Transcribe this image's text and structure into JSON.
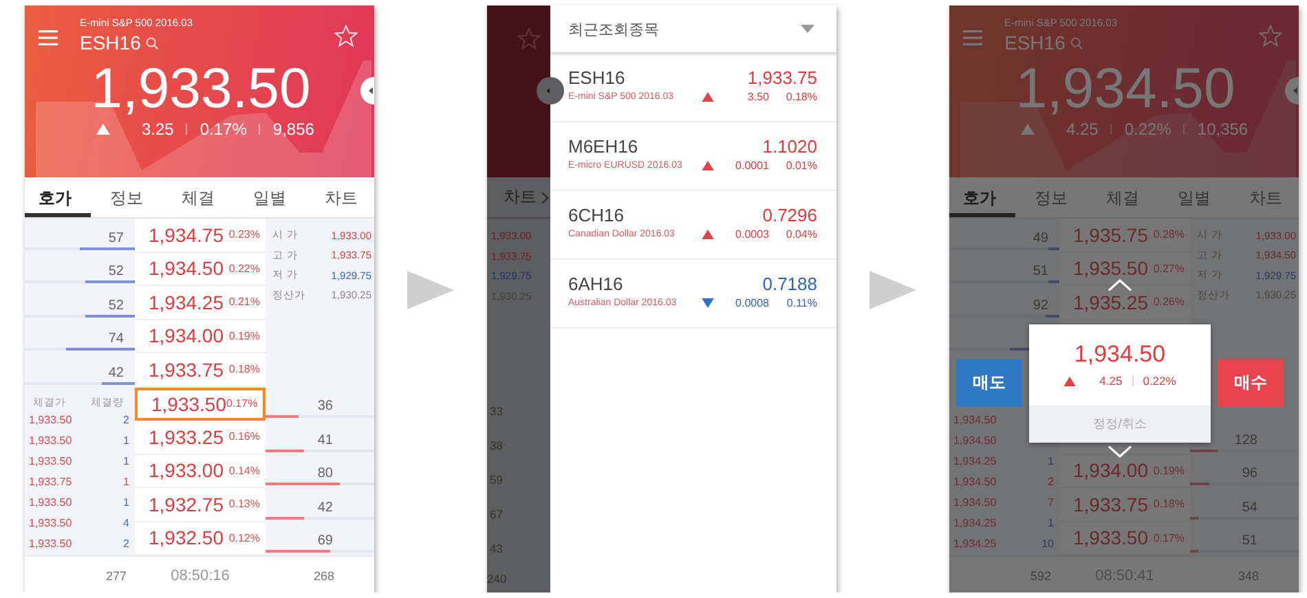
{
  "screens": [
    {
      "kind": "order_book",
      "dimmed": false,
      "header": {
        "subtitle": "E-mini S&P 500 2016.03",
        "symbol": "ESH16",
        "price": "1,933.50",
        "rising": true,
        "change": "3.25",
        "change_pct": "0.17%",
        "volume": "9,856"
      },
      "tabs": [
        {
          "label": "호가",
          "selected": true
        },
        {
          "label": "정보",
          "selected": false
        },
        {
          "label": "체결",
          "selected": false
        },
        {
          "label": "일별",
          "selected": false
        },
        {
          "label": "차트",
          "selected": false
        }
      ],
      "rows": [
        {
          "ask": {
            "qty": "57",
            "level": 0.5
          },
          "price": "1,934.75",
          "pct": "0.23%",
          "selected": false
        },
        {
          "ask": {
            "qty": "52",
            "level": 0.45
          },
          "price": "1,934.50",
          "pct": "0.22%",
          "selected": false
        },
        {
          "ask": {
            "qty": "52",
            "level": 0.45
          },
          "price": "1,934.25",
          "pct": "0.21%",
          "selected": false
        },
        {
          "ask": {
            "qty": "74",
            "level": 0.62
          },
          "price": "1,934.00",
          "pct": "0.19%",
          "selected": false
        },
        {
          "ask": {
            "qty": "42",
            "level": 0.3
          },
          "price": "1,933.75",
          "pct": "0.18%",
          "selected": false
        },
        {
          "bid": {
            "qty": "36",
            "level": 0.3
          },
          "price": "1,933.50",
          "pct": "0.17%",
          "selected": true
        },
        {
          "bid": {
            "qty": "41",
            "level": 0.35
          },
          "price": "1,933.25",
          "pct": "0.16%",
          "selected": false
        },
        {
          "bid": {
            "qty": "80",
            "level": 0.68
          },
          "price": "1,933.00",
          "pct": "0.14%",
          "selected": false
        },
        {
          "bid": {
            "qty": "42",
            "level": 0.35
          },
          "price": "1,932.75",
          "pct": "0.13%",
          "selected": false
        },
        {
          "bid": {
            "qty": "69",
            "level": 0.6
          },
          "price": "1,932.50",
          "pct": "0.12%",
          "selected": false
        }
      ],
      "summary": [
        {
          "label": "시 가",
          "value": "1,933.00",
          "color": "#e23a3e"
        },
        {
          "label": "고 가",
          "value": "1,933.75",
          "color": "#e23a3e"
        },
        {
          "label": "저 가",
          "value": "1,929.75",
          "color": "#3461c0"
        },
        {
          "label": "정산가",
          "value": "1,930.25",
          "color": "#888888"
        }
      ],
      "trades_header": [
        "체결가",
        "체결량"
      ],
      "trades": [
        {
          "price": "1,933.50",
          "qty": "2",
          "color": "#3f6cc4"
        },
        {
          "price": "1,933.50",
          "qty": "1",
          "color": "#3f6cc4"
        },
        {
          "price": "1,933.50",
          "qty": "1",
          "color": "#3f6cc4"
        },
        {
          "price": "1,933.75",
          "qty": "1",
          "color": "#e0484e"
        },
        {
          "price": "1,933.50",
          "qty": "1",
          "color": "#3f6cc4"
        },
        {
          "price": "1,933.50",
          "qty": "4",
          "color": "#3f6cc4"
        },
        {
          "price": "1,933.50",
          "qty": "2",
          "color": "#3f6cc4"
        }
      ],
      "footer": {
        "ask_total": "277",
        "time": "08:50:16",
        "bid_total": "268"
      }
    },
    {
      "kind": "recent_list",
      "background": {
        "tab": "차트",
        "summary": [
          {
            "value": "1,933.00",
            "color": "#6a2024"
          },
          {
            "value": "1,933.75",
            "color": "#6a2024"
          },
          {
            "value": "1,929.75",
            "color": "#22346a"
          },
          {
            "value": "1,930.25",
            "color": "#404042"
          }
        ],
        "quantities": [
          "33",
          "38",
          "59",
          "67",
          "43"
        ],
        "footer_value": "240"
      },
      "drawer": {
        "title": "최근조회종목",
        "items": [
          {
            "symbol": "ESH16",
            "name": "E-mini S&P 500 2016.03",
            "price": "1,933.75",
            "rising": true,
            "change": "3.50",
            "change_pct": "0.18%"
          },
          {
            "symbol": "M6EH16",
            "name": "E-micro EURUSD 2016.03",
            "price": "1.1020",
            "rising": true,
            "change": "0.0001",
            "change_pct": "0.01%"
          },
          {
            "symbol": "6CH16",
            "name": "Canadian Dollar 2016.03",
            "price": "0.7296",
            "rising": true,
            "change": "0.0003",
            "change_pct": "0.04%"
          },
          {
            "symbol": "6AH16",
            "name": "Australian Dollar 2016.03",
            "price": "0.7188",
            "rising": false,
            "change": "0.0008",
            "change_pct": "0.11%"
          }
        ]
      }
    },
    {
      "kind": "order_book",
      "dimmed": true,
      "header": {
        "subtitle": "E-mini S&P 500 2016.03",
        "symbol": "ESH16",
        "price": "1,934.50",
        "rising": true,
        "change": "4.25",
        "change_pct": "0.22%",
        "volume": "10,356"
      },
      "tabs": [
        {
          "label": "호가",
          "selected": true
        },
        {
          "label": "정보",
          "selected": false
        },
        {
          "label": "체결",
          "selected": false
        },
        {
          "label": "일별",
          "selected": false
        },
        {
          "label": "차트",
          "selected": false
        }
      ],
      "rows": [
        {
          "ask": {
            "qty": "49",
            "level": 0.1
          },
          "price": "1,935.75",
          "pct": "0.28%",
          "selected": false
        },
        {
          "ask": {
            "qty": "51",
            "level": 0.1
          },
          "price": "1,935.50",
          "pct": "0.27%",
          "selected": false
        },
        {
          "ask": {
            "qty": "92",
            "level": 0.12
          },
          "price": "1,935.25",
          "pct": "0.26%",
          "selected": false
        },
        {
          "ask": {
            "level": 0.45
          }
        },
        {},
        {},
        {
          "bid": {
            "qty": "128",
            "level": 0.25
          },
          "selected": false
        },
        {
          "bid": {
            "qty": "96",
            "level": 0.18
          },
          "price": "1,934.00",
          "pct": "0.19%",
          "selected": false
        },
        {
          "bid": {
            "qty": "54",
            "level": 0.08
          },
          "price": "1,933.75",
          "pct": "0.18%",
          "selected": false
        },
        {
          "bid": {
            "qty": "51",
            "level": 0.08
          },
          "price": "1,933.50",
          "pct": "0.17%",
          "selected": false
        }
      ],
      "summary": [
        {
          "label": "시 가",
          "value": "1,933.00",
          "color": "#6b282a"
        },
        {
          "label": "고 가",
          "value": "1,934.50",
          "color": "#6b282a"
        },
        {
          "label": "저 가",
          "value": "1,929.75",
          "color": "#26385e"
        },
        {
          "label": "정산가",
          "value": "1,930.25",
          "color": "#474747"
        }
      ],
      "trades": [
        {
          "price": "1,934.50"
        },
        {
          "price": "1,934.50"
        },
        {
          "price": "1,934.25",
          "qty": "1",
          "color": "#2a3c5f"
        },
        {
          "price": "1,934.50",
          "qty": "2",
          "color": "#6b2e30"
        },
        {
          "price": "1,934.50",
          "qty": "7",
          "color": "#6b2e30"
        },
        {
          "price": "1,934.25",
          "qty": "1",
          "color": "#2a3c5f"
        },
        {
          "price": "1,934.25",
          "qty": "10",
          "color": "#2a3c5f"
        }
      ],
      "footer": {
        "ask_total": "592",
        "time": "08:50:41",
        "bid_total": "348"
      },
      "popup": {
        "price": "1,934.50",
        "rising": true,
        "change": "4.25",
        "change_pct": "0.22%",
        "modify_button": "정정/취소",
        "sell_button": "매도",
        "buy_button": "매수"
      }
    }
  ]
}
